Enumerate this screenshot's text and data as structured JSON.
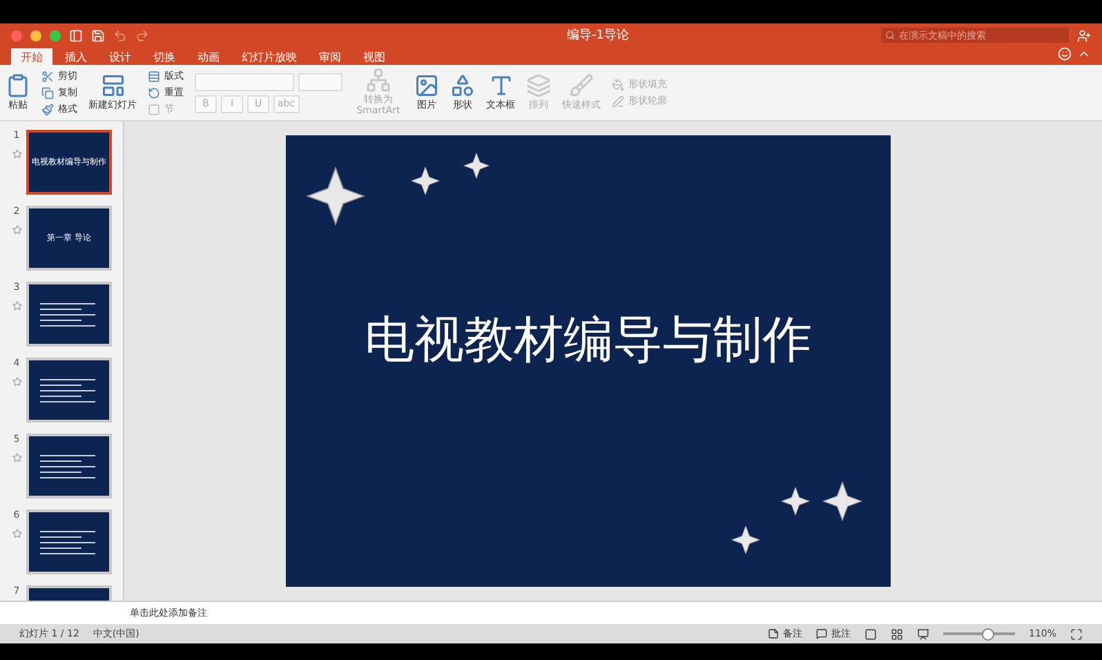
{
  "window": {
    "title": "编导-1导论"
  },
  "search": {
    "placeholder": "在演示文稿中的搜索"
  },
  "tabs": [
    {
      "label": "开始",
      "selected": true
    },
    {
      "label": "插入",
      "selected": false
    },
    {
      "label": "设计",
      "selected": false
    },
    {
      "label": "切换",
      "selected": false
    },
    {
      "label": "动画",
      "selected": false
    },
    {
      "label": "幻灯片放映",
      "selected": false
    },
    {
      "label": "审阅",
      "selected": false
    },
    {
      "label": "视图",
      "selected": false
    }
  ],
  "ribbon": [
    {
      "kind": "large",
      "label": "粘贴",
      "disabled": false
    },
    {
      "kind": "stack",
      "items": [
        {
          "label": "剪切",
          "disabled": false
        },
        {
          "label": "复制",
          "disabled": false
        },
        {
          "label": "格式",
          "disabled": false
        }
      ]
    },
    {
      "kind": "large",
      "label": "新建幻灯片",
      "disabled": false
    },
    {
      "kind": "stack",
      "items": [
        {
          "label": "版式",
          "disabled": false
        },
        {
          "label": "重置",
          "disabled": false
        },
        {
          "label": "节",
          "disabled": true
        }
      ]
    },
    {
      "kind": "font",
      "buttons": [
        {
          "label": "B"
        },
        {
          "label": "I"
        },
        {
          "label": "U"
        },
        {
          "label": "abc"
        }
      ]
    },
    {
      "kind": "large",
      "label": "转换为SmartArt",
      "disabled": true
    },
    {
      "kind": "large",
      "label": "图片",
      "disabled": false
    },
    {
      "kind": "large",
      "label": "形状",
      "disabled": false
    },
    {
      "kind": "large",
      "label": "文本框",
      "disabled": false
    },
    {
      "kind": "large",
      "label": "排列",
      "disabled": true
    },
    {
      "kind": "large",
      "label": "快速样式",
      "disabled": true
    },
    {
      "kind": "stack",
      "items": [
        {
          "label": "形状填充",
          "disabled": true
        },
        {
          "label": "形状轮廓",
          "disabled": true
        }
      ]
    }
  ],
  "thumbnails": [
    {
      "number": "1",
      "selected": true,
      "title": "电视教材编导与制作"
    },
    {
      "number": "2",
      "selected": false,
      "title": "第一章  导论"
    },
    {
      "number": "3",
      "selected": false
    },
    {
      "number": "4",
      "selected": false
    },
    {
      "number": "5",
      "selected": false
    },
    {
      "number": "6",
      "selected": false
    },
    {
      "number": "7",
      "selected": false
    }
  ],
  "slide": {
    "title": "电视教材编导与制作"
  },
  "notes": {
    "placeholder": "单击此处添加备注"
  },
  "status_bar": {
    "slide_counter": "幻灯片 1 / 12",
    "language": "中文(中国)",
    "notes": "备注",
    "comments": "批注",
    "zoom": "110%",
    "level": 0.62
  }
}
